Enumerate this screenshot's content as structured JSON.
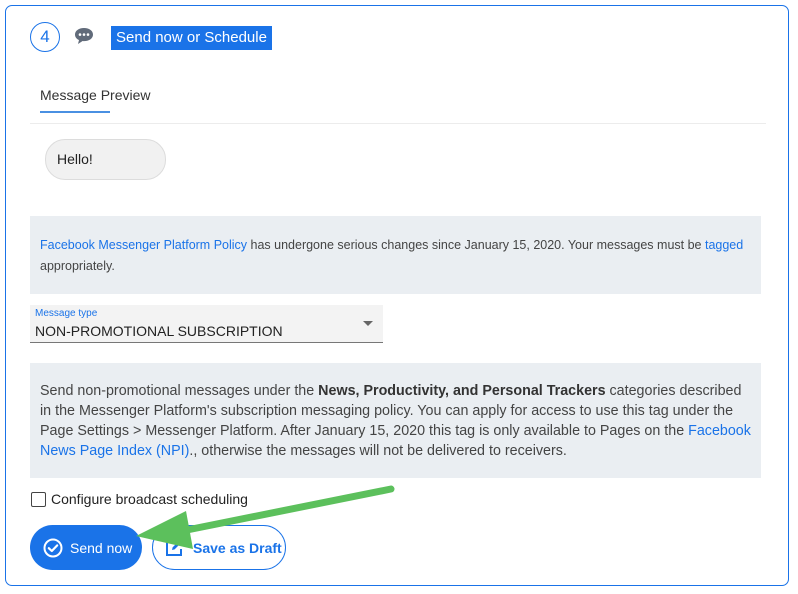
{
  "step": {
    "number": "4",
    "title": "Send now or Schedule",
    "icon": "chat-bubble-icon"
  },
  "tabs": [
    {
      "label": "Message Preview",
      "active": true
    }
  ],
  "preview": {
    "bubble_text": "Hello!"
  },
  "notice": {
    "link1": "Facebook Messenger Platform Policy",
    "text1": " has undergone serious changes since January 15, 2020. Your messages must be ",
    "link2": "tagged",
    "text2": " appropriately."
  },
  "message_type": {
    "label": "Message type",
    "value": "NON-PROMOTIONAL SUBSCRIPTION"
  },
  "info": {
    "text1": "Send non-promotional messages under the ",
    "bold": "News, Productivity, and Personal Trackers",
    "text2": " categories described in the Messenger Platform's subscription messaging policy. You can apply for access to use this tag under the Page Settings > Messenger Platform. After January 15, 2020 this tag is only available to Pages on the ",
    "link": "Facebook News Page Index (NPI)",
    "text3": "., otherwise the messages will not be delivered to receivers."
  },
  "scheduling": {
    "label": "Configure broadcast scheduling",
    "checked": false
  },
  "buttons": {
    "send_now": "Send now",
    "save_draft": "Save as Draft"
  },
  "colors": {
    "accent": "#1a73e8",
    "annotation_arrow": "#5cc05c"
  }
}
